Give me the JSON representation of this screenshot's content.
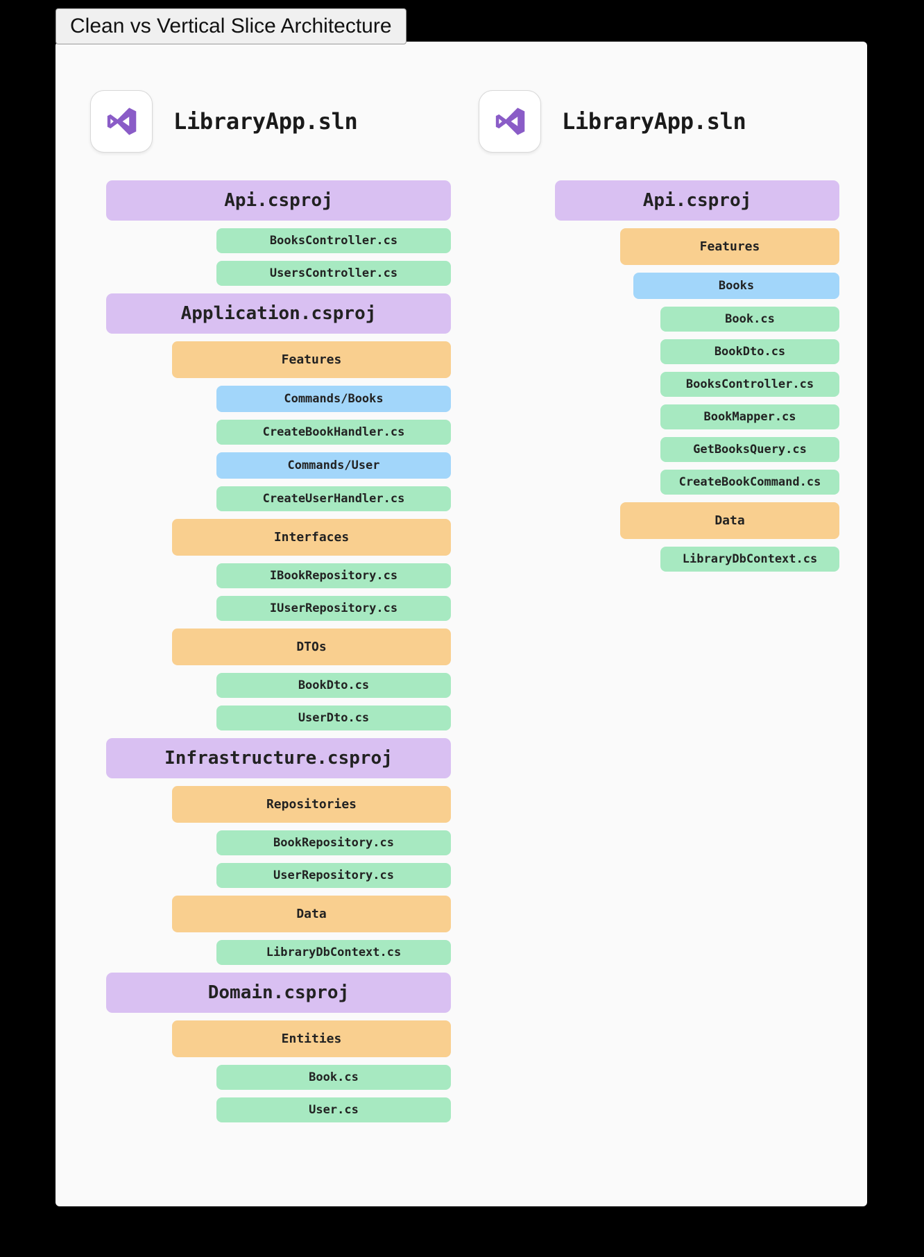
{
  "title": "Clean vs Vertical Slice Architecture",
  "solution_name": "LibraryApp.sln",
  "clean": {
    "projects": [
      {
        "name": "Api.csproj",
        "children": [
          {
            "type": "file",
            "name": "BooksController.cs"
          },
          {
            "type": "file",
            "name": "UsersController.cs"
          }
        ]
      },
      {
        "name": "Application.csproj",
        "children": [
          {
            "type": "folder",
            "name": "Features"
          },
          {
            "type": "subfolder",
            "name": "Commands/Books"
          },
          {
            "type": "file",
            "name": "CreateBookHandler.cs"
          },
          {
            "type": "subfolder",
            "name": "Commands/User"
          },
          {
            "type": "file",
            "name": "CreateUserHandler.cs"
          },
          {
            "type": "folder",
            "name": "Interfaces"
          },
          {
            "type": "file",
            "name": "IBookRepository.cs"
          },
          {
            "type": "file",
            "name": "IUserRepository.cs"
          },
          {
            "type": "folder",
            "name": "DTOs"
          },
          {
            "type": "file",
            "name": "BookDto.cs"
          },
          {
            "type": "file",
            "name": "UserDto.cs"
          }
        ]
      },
      {
        "name": "Infrastructure.csproj",
        "children": [
          {
            "type": "folder",
            "name": "Repositories"
          },
          {
            "type": "file",
            "name": "BookRepository.cs"
          },
          {
            "type": "file",
            "name": "UserRepository.cs"
          },
          {
            "type": "folder",
            "name": "Data"
          },
          {
            "type": "file",
            "name": "LibraryDbContext.cs"
          }
        ]
      },
      {
        "name": "Domain.csproj",
        "children": [
          {
            "type": "folder",
            "name": "Entities"
          },
          {
            "type": "file",
            "name": "Book.cs"
          },
          {
            "type": "file",
            "name": "User.cs"
          }
        ]
      }
    ]
  },
  "vertical_slice": {
    "projects": [
      {
        "name": "Api.csproj",
        "children": [
          {
            "type": "folder",
            "name": "Features"
          },
          {
            "type": "subfolder",
            "name": "Books"
          },
          {
            "type": "file",
            "name": "Book.cs"
          },
          {
            "type": "file",
            "name": "BookDto.cs"
          },
          {
            "type": "file",
            "name": "BooksController.cs"
          },
          {
            "type": "file",
            "name": "BookMapper.cs"
          },
          {
            "type": "file",
            "name": "GetBooksQuery.cs"
          },
          {
            "type": "file",
            "name": "CreateBookCommand.cs"
          },
          {
            "type": "folder",
            "name": "Data"
          },
          {
            "type": "file",
            "name": "LibraryDbContext.cs"
          }
        ]
      }
    ]
  }
}
